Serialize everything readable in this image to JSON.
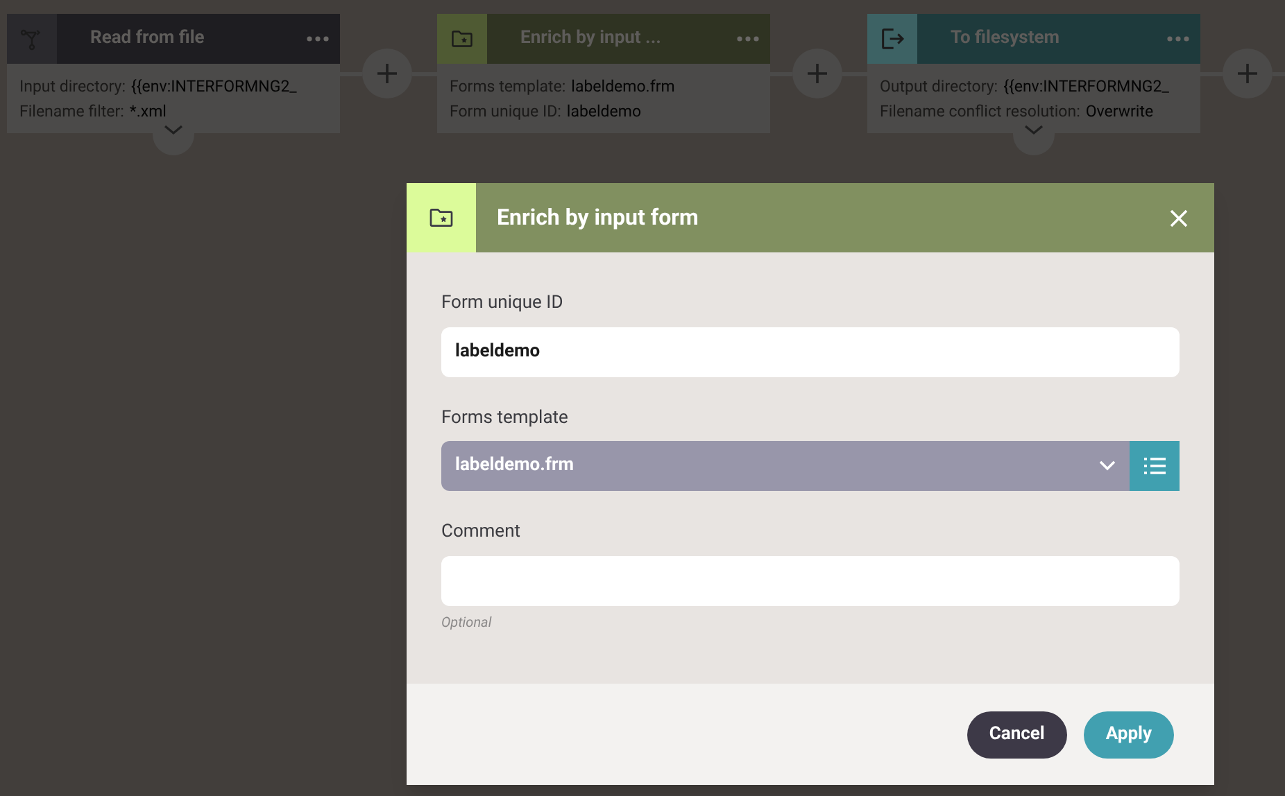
{
  "nodes": [
    {
      "kind": "read",
      "title": "Read from file",
      "fields": [
        {
          "label": "Input directory:",
          "value": "{{env:INTERFORMNG2_"
        },
        {
          "label": "Filename filter:",
          "value": "*.xml"
        }
      ],
      "expandable": true
    },
    {
      "kind": "enrich",
      "title": "Enrich by input ...",
      "fields": [
        {
          "label": "Forms template:",
          "value": "labeldemo.frm"
        },
        {
          "label": "Form unique ID:",
          "value": "labeldemo"
        }
      ],
      "expandable": false
    },
    {
      "kind": "output",
      "title": "To filesystem",
      "fields": [
        {
          "label": "Output directory:",
          "value": "{{env:INTERFORMNG2_"
        },
        {
          "label": "Filename conflict resolution:",
          "value": "Overwrite"
        }
      ],
      "expandable": true
    }
  ],
  "dialog": {
    "title": "Enrich by input form",
    "fields": [
      {
        "kind": "text",
        "label": "Form unique ID",
        "value": "labeldemo"
      },
      {
        "kind": "select",
        "label": "Forms template",
        "value": "labeldemo.frm"
      },
      {
        "kind": "text",
        "label": "Comment",
        "hint": "Optional"
      }
    ],
    "buttons": [
      {
        "kind": "secondary",
        "label": "Cancel"
      },
      {
        "kind": "primary",
        "label": "Apply"
      }
    ]
  }
}
